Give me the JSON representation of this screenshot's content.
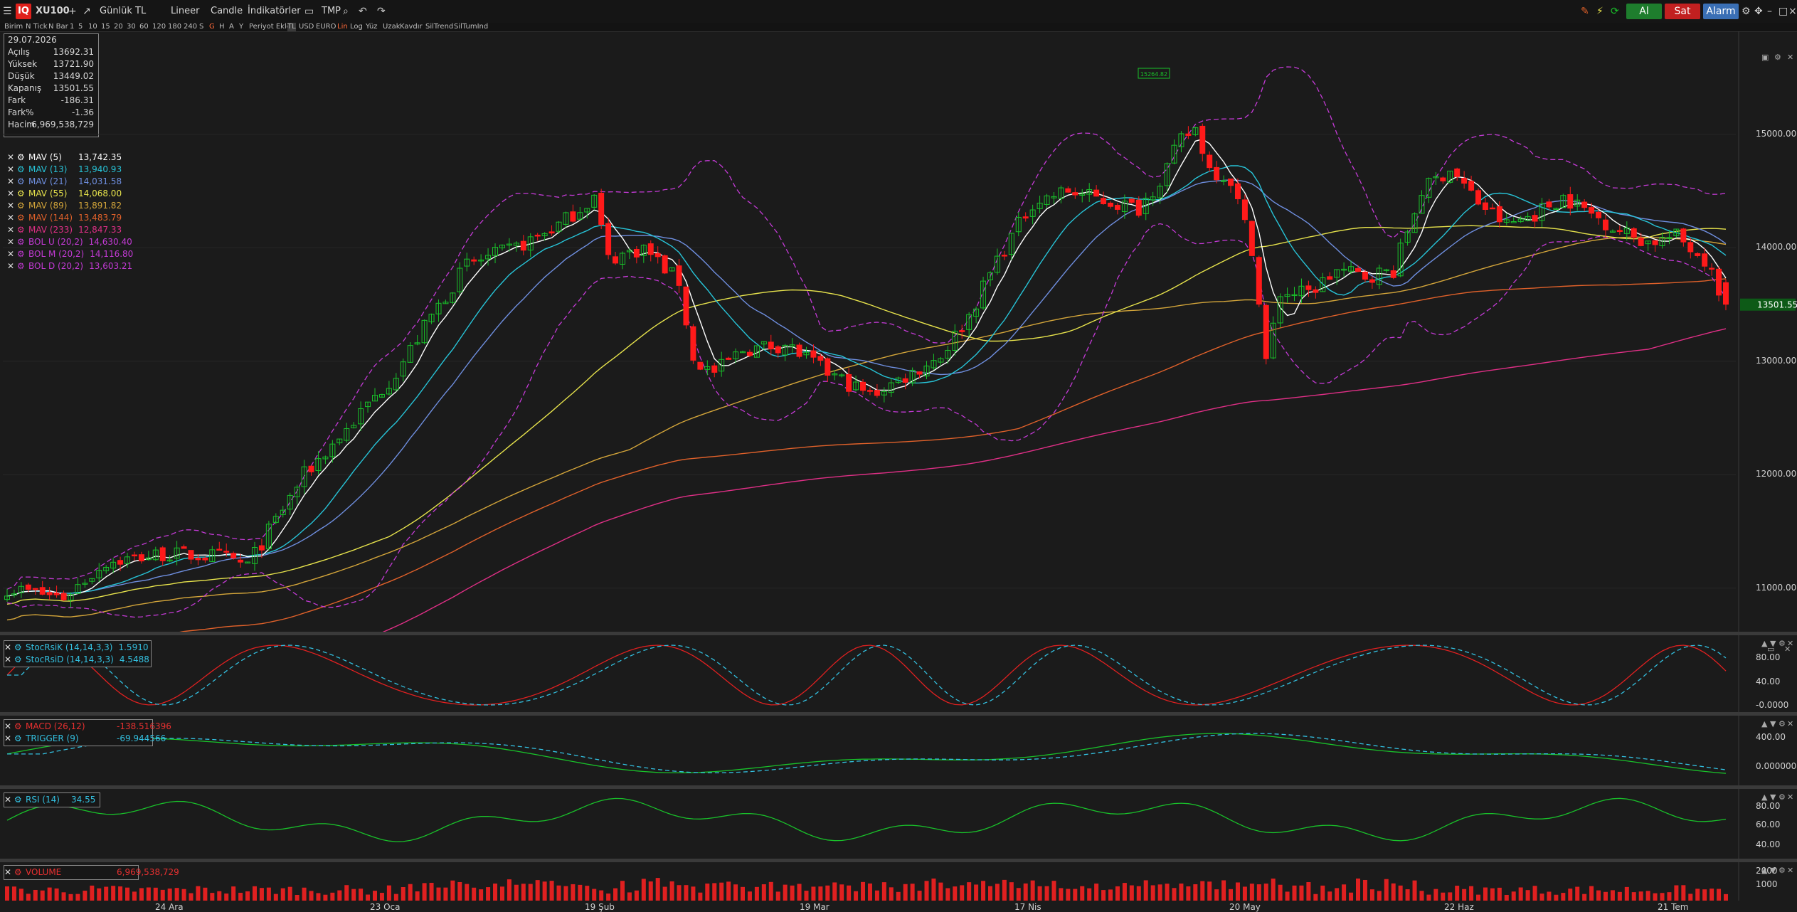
{
  "toolbar": {
    "symbol": "XU100",
    "period": "Günlük",
    "currency": "TL",
    "scale": "Lineer",
    "chart_style": "Candle",
    "indicators": "İndikatörler",
    "template": "TMP",
    "buy": "Al",
    "sell": "Sat",
    "alarm": "Alarm",
    "logo": "IQ"
  },
  "subbar": {
    "items": [
      "Birim",
      "N Tick",
      "N Bar",
      "1",
      "5",
      "10",
      "15",
      "20",
      "30",
      "60",
      "120",
      "180",
      "240",
      "S",
      "G",
      "H",
      "A",
      "Y",
      "Periyot Ekle",
      "TL",
      "USD",
      "EURO",
      "Lin",
      "Log",
      "Yüz",
      "Uzak",
      "Kavdır",
      "SilTrend",
      "SilTumInd"
    ]
  },
  "info": {
    "date": "29.07.2026",
    "rows": [
      {
        "label": "Açılış",
        "value": "13692.31"
      },
      {
        "label": "Yüksek",
        "value": "13721.90"
      },
      {
        "label": "Düşük",
        "value": "13449.02"
      },
      {
        "label": "Kapanış",
        "value": "13501.55"
      },
      {
        "label": "Fark",
        "value": "-186.31"
      },
      {
        "label": "Fark%",
        "value": "-1.36"
      },
      {
        "label": "Hacim",
        "value": "6,969,538,729"
      }
    ]
  },
  "legend_main": [
    {
      "label": "MAV (5)",
      "value": "13,742.35",
      "color": "#ffffff"
    },
    {
      "label": "MAV (13)",
      "value": "13,940.93",
      "color": "#27c4d8"
    },
    {
      "label": "MAV (21)",
      "value": "14,031.58",
      "color": "#6f8fe0"
    },
    {
      "label": "MAV (55)",
      "value": "14,068.00",
      "color": "#e7e34c"
    },
    {
      "label": "MAV (89)",
      "value": "13,891.82",
      "color": "#d3a53a"
    },
    {
      "label": "MAV (144)",
      "value": "13,483.79",
      "color": "#e0612a"
    },
    {
      "label": "MAV (233)",
      "value": "12,847.33",
      "color": "#df2f86"
    },
    {
      "label": "BOL U (20,2)",
      "value": "14,630.40",
      "color": "#c43ad6"
    },
    {
      "label": "BOL M (20,2)",
      "value": "14,116.80",
      "color": "#c43ad6"
    },
    {
      "label": "BOL D (20,2)",
      "value": "13,603.21",
      "color": "#c43ad6"
    }
  ],
  "price_axis": {
    "ticks": [
      "15000.00",
      "14000.00",
      "13000.00",
      "12000.00",
      "11000.00"
    ],
    "last_price": "13501.55",
    "peak_label": "15264.82"
  },
  "stoch_panel": {
    "legend": [
      {
        "label": "StocRsiK (14,14,3,3)",
        "value": "1.5910",
        "color": "#33c0e0"
      },
      {
        "label": "StocRsiD (14,14,3,3)",
        "value": "4.5488",
        "color": "#33c0e0"
      }
    ],
    "ticks": [
      "80.00",
      "40.00",
      "-0.0000"
    ]
  },
  "macd_panel": {
    "legend": [
      {
        "label": "MACD (26,12)",
        "value": "-138.516396",
        "color": "#e83030"
      },
      {
        "label": "TRIGGER (9)",
        "value": "-69.944566",
        "color": "#33c0e0"
      }
    ],
    "ticks": [
      "400.00",
      "0.000000"
    ]
  },
  "rsi_panel": {
    "legend": [
      {
        "label": "RSI (14)",
        "value": "34.55",
        "color": "#33c0e0"
      }
    ],
    "ticks": [
      "80.00",
      "60.00",
      "40.00"
    ]
  },
  "volume_panel": {
    "legend": [
      {
        "label": "VOLUME",
        "value": "6,969,538,729",
        "color": "#e83030"
      }
    ],
    "ticks": [
      "2000",
      "1000"
    ]
  },
  "x_axis": {
    "labels": [
      "24 Ara",
      "23 Oca",
      "19 Şub",
      "19 Mar",
      "17 Nis",
      "20 May",
      "22 Haz",
      "21 Tem"
    ]
  },
  "colors": {
    "up": "#19c12a",
    "down": "#ff1a1a",
    "background": "#1b1b1b",
    "buy": "#1e7d2d",
    "sell": "#c22020",
    "alarm": "#3a6fb5"
  }
}
